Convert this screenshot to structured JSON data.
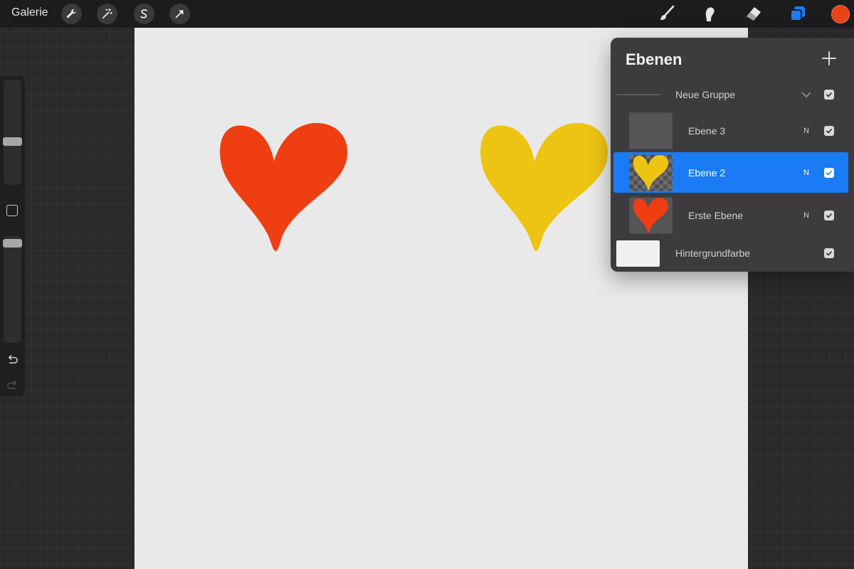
{
  "topbar": {
    "gallery_label": "Galerie",
    "tools": [
      "wrench-icon",
      "magic-wand-icon",
      "selection-icon",
      "transform-arrow-icon"
    ],
    "right_tools": [
      "brush-icon",
      "smudge-icon",
      "eraser-icon",
      "layers-icon"
    ],
    "current_color": "#ea4316"
  },
  "sidebar": {
    "brush_size_level": 0.4,
    "opacity_level": 0.0,
    "icons": [
      "modify-square-icon",
      "undo-icon",
      "redo-icon"
    ]
  },
  "canvas": {
    "hearts": [
      {
        "color": "#ef3e12"
      },
      {
        "color": "#edc412"
      }
    ]
  },
  "layers_panel": {
    "title": "Ebenen",
    "add_icon": "plus-icon",
    "group": {
      "name": "Neue Gruppe",
      "expand_icon": "chevron-down-icon",
      "visible": true
    },
    "layers": [
      {
        "name": "Ebene 3",
        "mode": "N",
        "visible": true,
        "selected": false
      },
      {
        "name": "Ebene 2",
        "mode": "N",
        "visible": true,
        "selected": true
      },
      {
        "name": "Erste Ebene",
        "mode": "N",
        "visible": true,
        "selected": false
      }
    ],
    "background": {
      "name": "Hintergrundfarbe",
      "visible": true,
      "color": "#f0f0f0"
    },
    "accent_color": "#1a7cf4"
  }
}
